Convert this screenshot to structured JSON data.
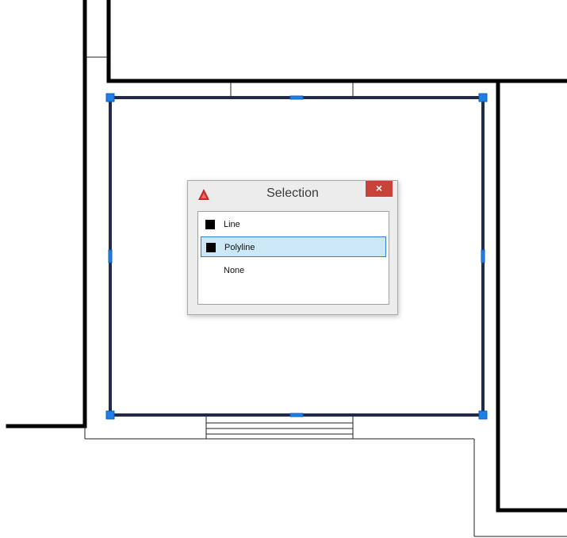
{
  "dialog": {
    "title": "Selection",
    "close_symbol": "×",
    "app_icon": "autocad-logo-icon",
    "items": [
      {
        "label": "Line",
        "swatch": true,
        "selected": false
      },
      {
        "label": "Polyline",
        "swatch": true,
        "selected": true
      },
      {
        "label": "None",
        "swatch": false,
        "selected": false
      }
    ]
  },
  "colors": {
    "wall": "#000000",
    "selection_outline": "#1f2b48",
    "grip": "#1e7fe8",
    "list_highlight": "#cce8f7",
    "close_button": "#c7433a"
  }
}
